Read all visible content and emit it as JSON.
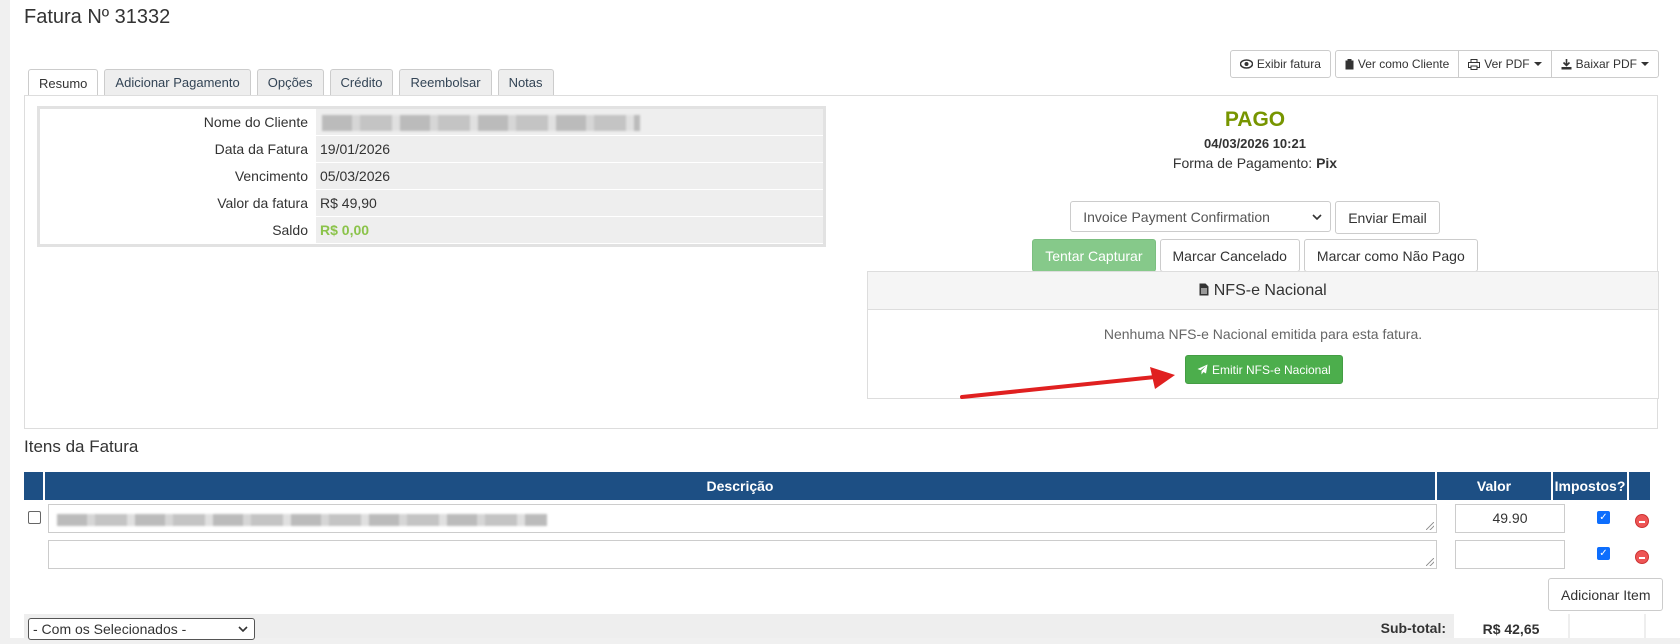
{
  "page_title": "Fatura Nº 31332",
  "toolbar": {
    "view_invoice": "Exibir fatura",
    "view_as_client": "Ver como Cliente",
    "view_pdf": "Ver PDF",
    "download_pdf": "Baixar PDF"
  },
  "tabs": [
    {
      "label": "Resumo",
      "active": true
    },
    {
      "label": "Adicionar Pagamento"
    },
    {
      "label": "Opções"
    },
    {
      "label": "Crédito"
    },
    {
      "label": "Reembolsar"
    },
    {
      "label": "Notas"
    }
  ],
  "summary": {
    "client_name_label": "Nome do Cliente",
    "invoice_date_label": "Data da Fatura",
    "invoice_date": "19/01/2026",
    "due_label": "Vencimento",
    "due_date": "05/03/2026",
    "amount_label": "Valor da fatura",
    "amount": "R$ 49,90",
    "balance_label": "Saldo",
    "balance": "R$ 0,00"
  },
  "status": {
    "state": "PAGO",
    "paid_date": "04/03/2026 10:21",
    "payment_method_label": "Forma de Pagamento:",
    "payment_method": "Pix",
    "email_template": "Invoice Payment Confirmation",
    "send_email": "Enviar Email",
    "try_capture": "Tentar Capturar",
    "mark_cancelled": "Marcar Cancelado",
    "mark_unpaid": "Marcar como Não Pago"
  },
  "nfs": {
    "title": "NFS-e Nacional",
    "message": "Nenhuma NFS-e Nacional emitida para esta fatura.",
    "emit_button": "Emitir NFS-e Nacional"
  },
  "items": {
    "title": "Itens da Fatura",
    "columns": {
      "description": "Descrição",
      "value": "Valor",
      "taxes": "Impostos?"
    },
    "rows": [
      {
        "value": "49.90",
        "taxed": true
      },
      {
        "value": "",
        "taxed": true
      }
    ],
    "add_item": "Adicionar Item",
    "bulk_select": "- Com os Selecionados -",
    "subtotal_label": "Sub-total:",
    "subtotal": "R$ 42,65"
  },
  "colors": {
    "paid_green": "#779500",
    "balance_green": "#8bc34a",
    "table_header": "#1d4f84",
    "emit_green": "#4cae4c",
    "annotation_arrow": "#e02020"
  }
}
